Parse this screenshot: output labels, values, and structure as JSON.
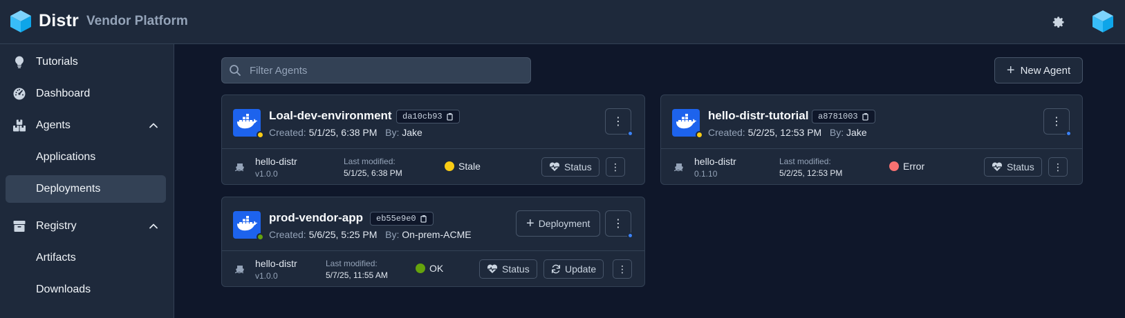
{
  "header": {
    "brand": "Distr",
    "platform": "Vendor Platform",
    "logo_icon": "cube-icon",
    "settings_icon": "gear-icon",
    "avatar_icon": "cube-icon"
  },
  "sidebar": {
    "items": [
      {
        "label": "Tutorials",
        "icon": "lightbulb-icon"
      },
      {
        "label": "Dashboard",
        "icon": "gauge-icon"
      },
      {
        "label": "Agents",
        "icon": "boxes-icon",
        "expanded": true
      },
      {
        "label": "Applications"
      },
      {
        "label": "Deployments",
        "active": true
      },
      {
        "label": "Registry",
        "icon": "package-icon",
        "expanded": true
      },
      {
        "label": "Artifacts"
      },
      {
        "label": "Downloads"
      }
    ]
  },
  "toolbar": {
    "filter_placeholder": "Filter Agents",
    "new_agent_label": "New Agent"
  },
  "agents": [
    {
      "name": "Loal-dev-environment",
      "id": "da10cb93",
      "created_label": "Created:",
      "created": "5/1/25, 6:38 PM",
      "by_label": "By:",
      "by": "Jake",
      "agent_status_color": "#facc15",
      "deployment": {
        "name": "hello-distr",
        "version": "v1.0.0",
        "last_modified_label": "Last modified:",
        "last_modified": "5/1/25, 6:38 PM",
        "status": "Stale",
        "status_color": "#facc15",
        "status_button": "Status"
      }
    },
    {
      "name": "hello-distr-tutorial",
      "id": "a8781003",
      "created_label": "Created:",
      "created": "5/2/25, 12:53 PM",
      "by_label": "By:",
      "by": "Jake",
      "agent_status_color": "#facc15",
      "deployment": {
        "name": "hello-distr",
        "version": "0.1.10",
        "last_modified_label": "Last modified:",
        "last_modified": "5/2/25, 12:53 PM",
        "status": "Error",
        "status_color": "#f87171",
        "status_button": "Status"
      }
    },
    {
      "name": "prod-vendor-app",
      "id": "eb55e9e0",
      "created_label": "Created:",
      "created": "5/6/25, 5:25 PM",
      "by_label": "By:",
      "by": "On-prem-ACME",
      "agent_status_color": "#65a30d",
      "add_deployment_label": "Deployment",
      "deployment": {
        "name": "hello-distr",
        "version": "v1.0.0",
        "last_modified_label": "Last modified:",
        "last_modified": "5/7/25, 11:55 AM",
        "status": "OK",
        "status_color": "#65a30d",
        "status_button": "Status",
        "update_button": "Update"
      }
    }
  ]
}
